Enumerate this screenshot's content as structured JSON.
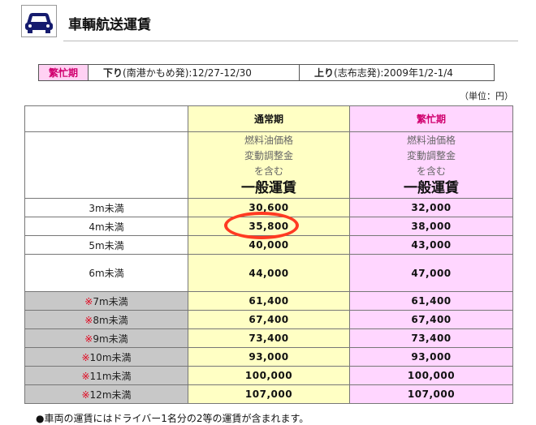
{
  "header": {
    "title": "車輌航送運賃",
    "icon": "car-icon"
  },
  "season": {
    "busy_label": "繁忙期",
    "down_bold": "下り",
    "down_text": "(南港かもめ発):12/27-12/30",
    "up_bold": "上り",
    "up_text": "(志布志発):2009年1/2-1/4"
  },
  "unit": "（単位：円）",
  "table": {
    "col_normal": "通常期",
    "col_busy": "繁忙期",
    "desc_line1": "燃料油価格",
    "desc_line2": "変動調整金",
    "desc_line3": "を含む",
    "desc_big": "一般運賃",
    "rows": [
      {
        "mark": "",
        "label": "3m未満",
        "normal": "30,600",
        "busy": "32,000"
      },
      {
        "mark": "",
        "label": "4m未満",
        "normal": "35,800",
        "busy": "38,000"
      },
      {
        "mark": "",
        "label": "5m未満",
        "normal": "40,000",
        "busy": "43,000"
      },
      {
        "mark": "",
        "label": "6m未満",
        "normal": "44,000",
        "busy": "47,000"
      },
      {
        "mark": "※",
        "label": "7m未満",
        "normal": "61,400",
        "busy": "61,400"
      },
      {
        "mark": "※",
        "label": "8m未満",
        "normal": "67,400",
        "busy": "67,400"
      },
      {
        "mark": "※",
        "label": "9m未満",
        "normal": "73,400",
        "busy": "73,400"
      },
      {
        "mark": "※",
        "label": "10m未満",
        "normal": "93,000",
        "busy": "93,000"
      },
      {
        "mark": "※",
        "label": "11m未満",
        "normal": "100,000",
        "busy": "100,000"
      },
      {
        "mark": "※",
        "label": "12m未満",
        "normal": "107,000",
        "busy": "107,000"
      }
    ]
  },
  "note": "●車両の運賃にはドライバー1名分の2等の運賃が含まれます。",
  "colors": {
    "normal_bg": "#ffffc4",
    "busy_bg": "#ffd6ff",
    "busy_text": "#d0006f",
    "highlight_circle": "#ff3a22"
  }
}
